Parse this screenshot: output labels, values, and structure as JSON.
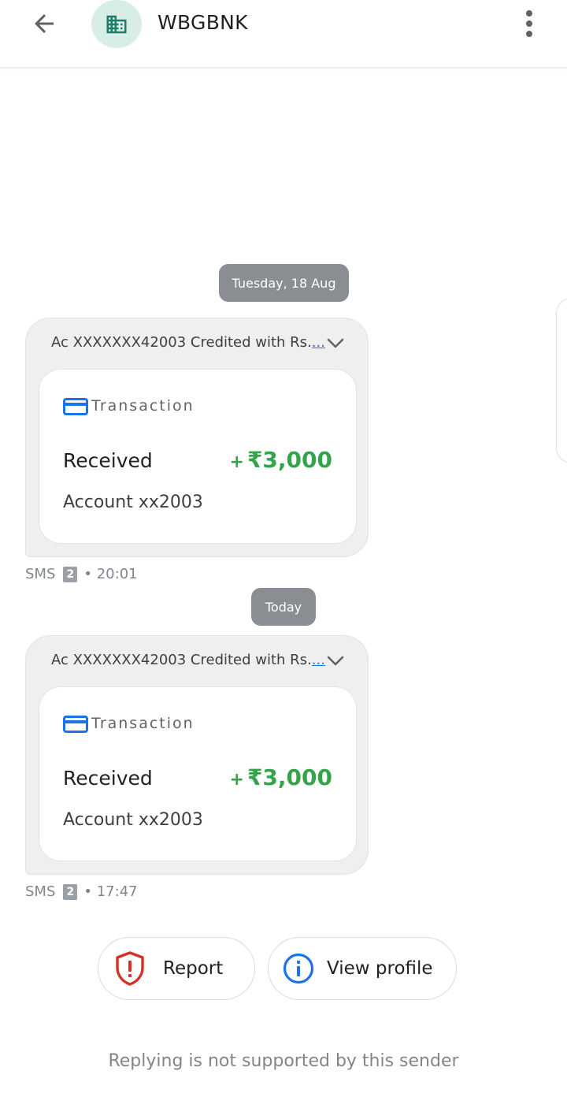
{
  "header": {
    "title": "WBGBNK",
    "back_icon": "arrow-back-icon",
    "avatar_icon": "business-building-icon",
    "more_icon": "more-vert-icon",
    "avatar_bg": "#d7ede6",
    "avatar_fg": "#1e7d68"
  },
  "messages": [
    {
      "date": "Tuesday, 18 Aug",
      "preview": "Ac XXXXXXX42003 Credited with Rs.",
      "preview_more": "...",
      "card_type": "Transaction",
      "status": "Received",
      "amount_sign": "+",
      "amount": "₹3,000",
      "account": "Account xx2003",
      "channel": "SMS",
      "sim": "2",
      "time": "• 20:01"
    },
    {
      "date": "Today",
      "preview": "Ac XXXXXXX42003 Credited with Rs.",
      "preview_more": "...",
      "card_type": "Transaction",
      "status": "Received",
      "amount_sign": "+",
      "amount": "₹3,000",
      "account": "Account xx2003",
      "channel": "SMS",
      "sim": "2",
      "time": "• 17:47"
    }
  ],
  "actions": {
    "report_label": "Report",
    "report_icon": "shield-alert-icon",
    "view_profile_label": "View profile",
    "view_profile_icon": "info-icon"
  },
  "footer": {
    "note": "Replying is not supported by this sender"
  },
  "colors": {
    "amount_green": "#34a44a",
    "link_blue": "#1a73e8",
    "report_red": "#d93025",
    "date_pill": "#8a8d91"
  }
}
